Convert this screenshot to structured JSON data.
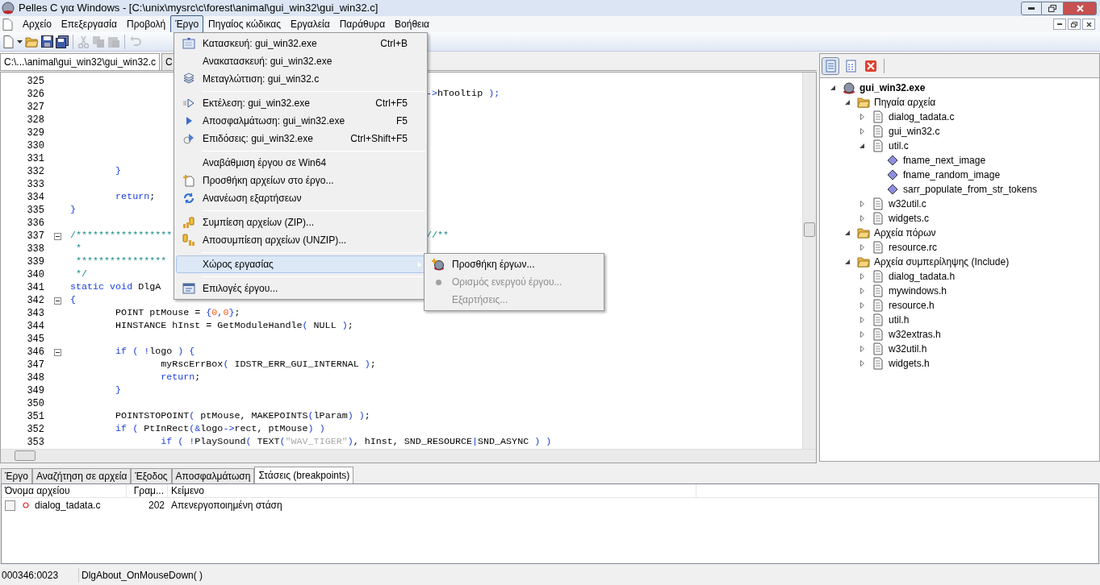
{
  "window": {
    "title": "Pelles C για Windows - [C:\\unix\\mysrc\\c\\forest\\animal\\gui_win32\\gui_win32.c]"
  },
  "menubar": [
    {
      "label": "Αρχείο",
      "selected": false
    },
    {
      "label": "Επεξεργασία",
      "selected": false
    },
    {
      "label": "Προβολή",
      "selected": false
    },
    {
      "label": "Έργο",
      "selected": true
    },
    {
      "label": "Πηγαίος κώδικας",
      "selected": false
    },
    {
      "label": "Εργαλεία",
      "selected": false
    },
    {
      "label": "Παράθυρα",
      "selected": false
    },
    {
      "label": "Βοήθεια",
      "selected": false
    }
  ],
  "toolbar": [
    {
      "kind": "new",
      "disabled": false
    },
    {
      "kind": "dropdown",
      "disabled": false
    },
    {
      "kind": "open",
      "disabled": false
    },
    {
      "kind": "save",
      "disabled": false
    },
    {
      "kind": "saveall",
      "disabled": false
    },
    {
      "kind": "cut",
      "disabled": true
    },
    {
      "kind": "copy",
      "disabled": true
    },
    {
      "kind": "paste",
      "disabled": true
    },
    {
      "kind": "undo",
      "disabled": true
    }
  ],
  "editor_tabs": [
    {
      "label": "C:\\...\\animal\\gui_win32\\gui_win32.c",
      "selected": true
    },
    {
      "label": "C",
      "selected": false
    }
  ],
  "code_lines": [
    {
      "n": "325",
      "fold_start": false
    },
    {
      "n": "326",
      "fold_start": false,
      "right": [
        {
          "kind": "punct",
          "text": "->"
        },
        {
          "kind": "plain",
          "text": "hTooltip "
        },
        {
          "kind": "punct",
          "text": ");"
        }
      ]
    },
    {
      "n": "327",
      "fold_start": false
    },
    {
      "n": "328",
      "fold_start": false
    },
    {
      "n": "329",
      "fold_start": false
    },
    {
      "n": "330",
      "fold_start": false
    },
    {
      "n": "331",
      "fold_start": false
    },
    {
      "n": "332",
      "fold_start": false,
      "left": [
        {
          "kind": "punct",
          "text": "        }"
        }
      ]
    },
    {
      "n": "333",
      "fold_start": false
    },
    {
      "n": "334",
      "fold_start": false,
      "left": [
        {
          "kind": "keyword",
          "text": "        return"
        },
        {
          "kind": "plain",
          "text": ";"
        }
      ]
    },
    {
      "n": "335",
      "fold_start": false,
      "left": [
        {
          "kind": "punct",
          "text": "}"
        }
      ]
    },
    {
      "n": "336",
      "fold_start": false
    },
    {
      "n": "337",
      "fold_start": true,
      "left": [
        {
          "kind": "comment",
          "text": "/*****************"
        }
      ],
      "right": [
        {
          "kind": "comment",
          "text": "//**"
        }
      ]
    },
    {
      "n": "338",
      "fold_start": false,
      "left": [
        {
          "kind": "comment",
          "text": " *"
        }
      ]
    },
    {
      "n": "339",
      "fold_start": false,
      "left": [
        {
          "kind": "comment",
          "text": " ****************"
        }
      ]
    },
    {
      "n": "340",
      "fold_start": false,
      "left": [
        {
          "kind": "comment",
          "text": " */"
        }
      ]
    },
    {
      "n": "341",
      "fold_start": false,
      "left": [
        {
          "kind": "keyword",
          "text": "static void "
        },
        {
          "kind": "plain",
          "text": "DlgA"
        }
      ]
    },
    {
      "n": "342",
      "fold_start": true,
      "left": [
        {
          "kind": "punct",
          "text": "{"
        }
      ]
    },
    {
      "n": "343",
      "fold_start": false,
      "left": [
        {
          "kind": "plain",
          "text": "        POINT ptMouse = "
        },
        {
          "kind": "punct",
          "text": "{"
        },
        {
          "kind": "number",
          "text": "0"
        },
        {
          "kind": "punct",
          "text": ","
        },
        {
          "kind": "number",
          "text": "0"
        },
        {
          "kind": "punct",
          "text": "}"
        },
        {
          "kind": "plain",
          "text": ";"
        }
      ]
    },
    {
      "n": "344",
      "fold_start": false,
      "left": [
        {
          "kind": "plain",
          "text": "        HINSTANCE hInst = GetModuleHandle"
        },
        {
          "kind": "punct",
          "text": "( "
        },
        {
          "kind": "plain",
          "text": "NULL "
        },
        {
          "kind": "punct",
          "text": ")"
        },
        {
          "kind": "plain",
          "text": ";"
        }
      ]
    },
    {
      "n": "345",
      "fold_start": false
    },
    {
      "n": "346",
      "fold_start": true,
      "left": [
        {
          "kind": "keyword",
          "text": "        if "
        },
        {
          "kind": "punct",
          "text": "( !"
        },
        {
          "kind": "plain",
          "text": "logo "
        },
        {
          "kind": "punct",
          "text": ") {"
        }
      ]
    },
    {
      "n": "347",
      "fold_start": false,
      "left": [
        {
          "kind": "plain",
          "text": "                myRscErrBox"
        },
        {
          "kind": "punct",
          "text": "( "
        },
        {
          "kind": "plain",
          "text": "IDSTR_ERR_GUI_INTERNAL "
        },
        {
          "kind": "punct",
          "text": ")"
        },
        {
          "kind": "plain",
          "text": ";"
        }
      ]
    },
    {
      "n": "348",
      "fold_start": false,
      "left": [
        {
          "kind": "keyword",
          "text": "                return"
        },
        {
          "kind": "plain",
          "text": ";"
        }
      ]
    },
    {
      "n": "349",
      "fold_start": false,
      "left": [
        {
          "kind": "punct",
          "text": "        }"
        }
      ]
    },
    {
      "n": "350",
      "fold_start": false
    },
    {
      "n": "351",
      "fold_start": false,
      "left": [
        {
          "kind": "plain",
          "text": "        POINTSTOPOINT"
        },
        {
          "kind": "punct",
          "text": "( "
        },
        {
          "kind": "plain",
          "text": "ptMouse, MAKEPOINTS"
        },
        {
          "kind": "punct",
          "text": "("
        },
        {
          "kind": "plain",
          "text": "lParam"
        },
        {
          "kind": "punct",
          "text": ") )"
        },
        {
          "kind": "plain",
          "text": ";"
        }
      ]
    },
    {
      "n": "352",
      "fold_start": false,
      "left": [
        {
          "kind": "keyword",
          "text": "        if "
        },
        {
          "kind": "punct",
          "text": "( "
        },
        {
          "kind": "plain",
          "text": "PtInRect"
        },
        {
          "kind": "punct",
          "text": "(&"
        },
        {
          "kind": "plain",
          "text": "logo"
        },
        {
          "kind": "punct",
          "text": "->"
        },
        {
          "kind": "plain",
          "text": "rect, ptMouse"
        },
        {
          "kind": "punct",
          "text": ") )"
        }
      ]
    },
    {
      "n": "353",
      "fold_start": false,
      "left": [
        {
          "kind": "keyword",
          "text": "                if "
        },
        {
          "kind": "punct",
          "text": "( !"
        },
        {
          "kind": "plain",
          "text": "PlaySound"
        },
        {
          "kind": "punct",
          "text": "( "
        },
        {
          "kind": "plain",
          "text": "TEXT"
        },
        {
          "kind": "punct",
          "text": "("
        },
        {
          "kind": "string",
          "text": "\"WAV_TIGER\""
        },
        {
          "kind": "punct",
          "text": ")"
        },
        {
          "kind": "plain",
          "text": ", hInst, SND_RESOURCE"
        },
        {
          "kind": "punct",
          "text": "|"
        },
        {
          "kind": "plain",
          "text": "SND_ASYNC "
        },
        {
          "kind": "punct",
          "text": ") )"
        }
      ]
    }
  ],
  "project_menu": [
    [
      {
        "label": "Κατασκευή: gui_win32.exe",
        "shortcut": "Ctrl+B",
        "selected": false
      },
      {
        "label": "Ανακατασκευή: gui_win32.exe",
        "selected": false
      },
      {
        "label": "Μεταγλώττιση: gui_win32.c",
        "selected": false
      }
    ],
    [
      {
        "label": "Εκτέλεση: gui_win32.exe",
        "shortcut": "Ctrl+F5",
        "selected": false
      },
      {
        "label": "Αποσφαλμάτωση: gui_win32.exe",
        "shortcut": "F5",
        "selected": false
      },
      {
        "label": "Επιδόσεις: gui_win32.exe",
        "shortcut": "Ctrl+Shift+F5",
        "selected": false
      }
    ],
    [
      {
        "label": "Αναβάθμιση έργου σε Win64",
        "selected": false
      },
      {
        "label": "Προσθήκη αρχείων στο έργο...",
        "selected": false
      },
      {
        "label": "Ανανέωση εξαρτήσεων",
        "selected": false
      }
    ],
    [
      {
        "label": "Συμπίεση αρχείων (ZIP)...",
        "selected": false
      },
      {
        "label": "Αποσυμπίεση αρχείων (UNZIP)...",
        "selected": false
      }
    ],
    [
      {
        "label": "Χώρος εργασίας",
        "selected": true,
        "submenu": true
      }
    ],
    [
      {
        "label": "Επιλογές έργου...",
        "selected": false
      }
    ]
  ],
  "workspace_submenu": [
    {
      "label": "Προσθήκη έργων...",
      "disabled": false
    },
    {
      "label": "Ορισμός ενεργού έργου...",
      "disabled": true
    },
    {
      "label": "Εξαρτήσεις...",
      "disabled": true
    }
  ],
  "project_panel": {
    "toolbar": [
      {
        "selected": true
      },
      {
        "selected": false
      },
      {
        "selected": false
      }
    ],
    "tree": [
      {
        "label": "gui_win32.exe",
        "kind": "project",
        "expanded": true,
        "children": [
          {
            "label": "Πηγαία αρχεία",
            "kind": "folder",
            "expanded": true,
            "children": [
              {
                "label": "dialog_tadata.c",
                "kind": "file",
                "expanded": false
              },
              {
                "label": "gui_win32.c",
                "kind": "file",
                "expanded": false
              },
              {
                "label": "util.c",
                "kind": "file",
                "expanded": true,
                "children": [
                  {
                    "label": "fname_next_image",
                    "kind": "function"
                  },
                  {
                    "label": "fname_random_image",
                    "kind": "function"
                  },
                  {
                    "label": "sarr_populate_from_str_tokens",
                    "kind": "function"
                  }
                ]
              },
              {
                "label": "w32util.c",
                "kind": "file",
                "expanded": false
              },
              {
                "label": "widgets.c",
                "kind": "file",
                "expanded": false
              }
            ]
          },
          {
            "label": "Αρχεία πόρων",
            "kind": "folder",
            "expanded": true,
            "children": [
              {
                "label": "resource.rc",
                "kind": "file",
                "expanded": false
              }
            ]
          },
          {
            "label": "Αρχεία συμπερίληψης (Include)",
            "kind": "folder",
            "expanded": true,
            "children": [
              {
                "label": "dialog_tadata.h",
                "kind": "file",
                "expanded": false
              },
              {
                "label": "mywindows.h",
                "kind": "file",
                "expanded": false
              },
              {
                "label": "resource.h",
                "kind": "file",
                "expanded": false
              },
              {
                "label": "util.h",
                "kind": "file",
                "expanded": false
              },
              {
                "label": "w32extras.h",
                "kind": "file",
                "expanded": false
              },
              {
                "label": "w32util.h",
                "kind": "file",
                "expanded": false
              },
              {
                "label": "widgets.h",
                "kind": "file",
                "expanded": false
              }
            ]
          }
        ]
      }
    ]
  },
  "bottom_tabs": [
    {
      "label": "Έργο",
      "selected": false
    },
    {
      "label": "Αναζήτηση σε αρχεία",
      "selected": false
    },
    {
      "label": "Έξοδος",
      "selected": false
    },
    {
      "label": "Αποσφαλμάτωση",
      "selected": false
    },
    {
      "label": "Στάσεις (breakpoints)",
      "selected": true
    }
  ],
  "breakpoints": {
    "columns": [
      "Όνομα αρχείου",
      "Γραμ...",
      "Κείμενο"
    ],
    "rows": [
      {
        "checked": false,
        "enabled": false,
        "file": "dialog_tadata.c",
        "line": "202",
        "text": "Απενεργοποιημένη στάση"
      }
    ]
  },
  "status_bar": {
    "position": "000346:0023",
    "function": "DlgAbout_OnMouseDown( )"
  }
}
